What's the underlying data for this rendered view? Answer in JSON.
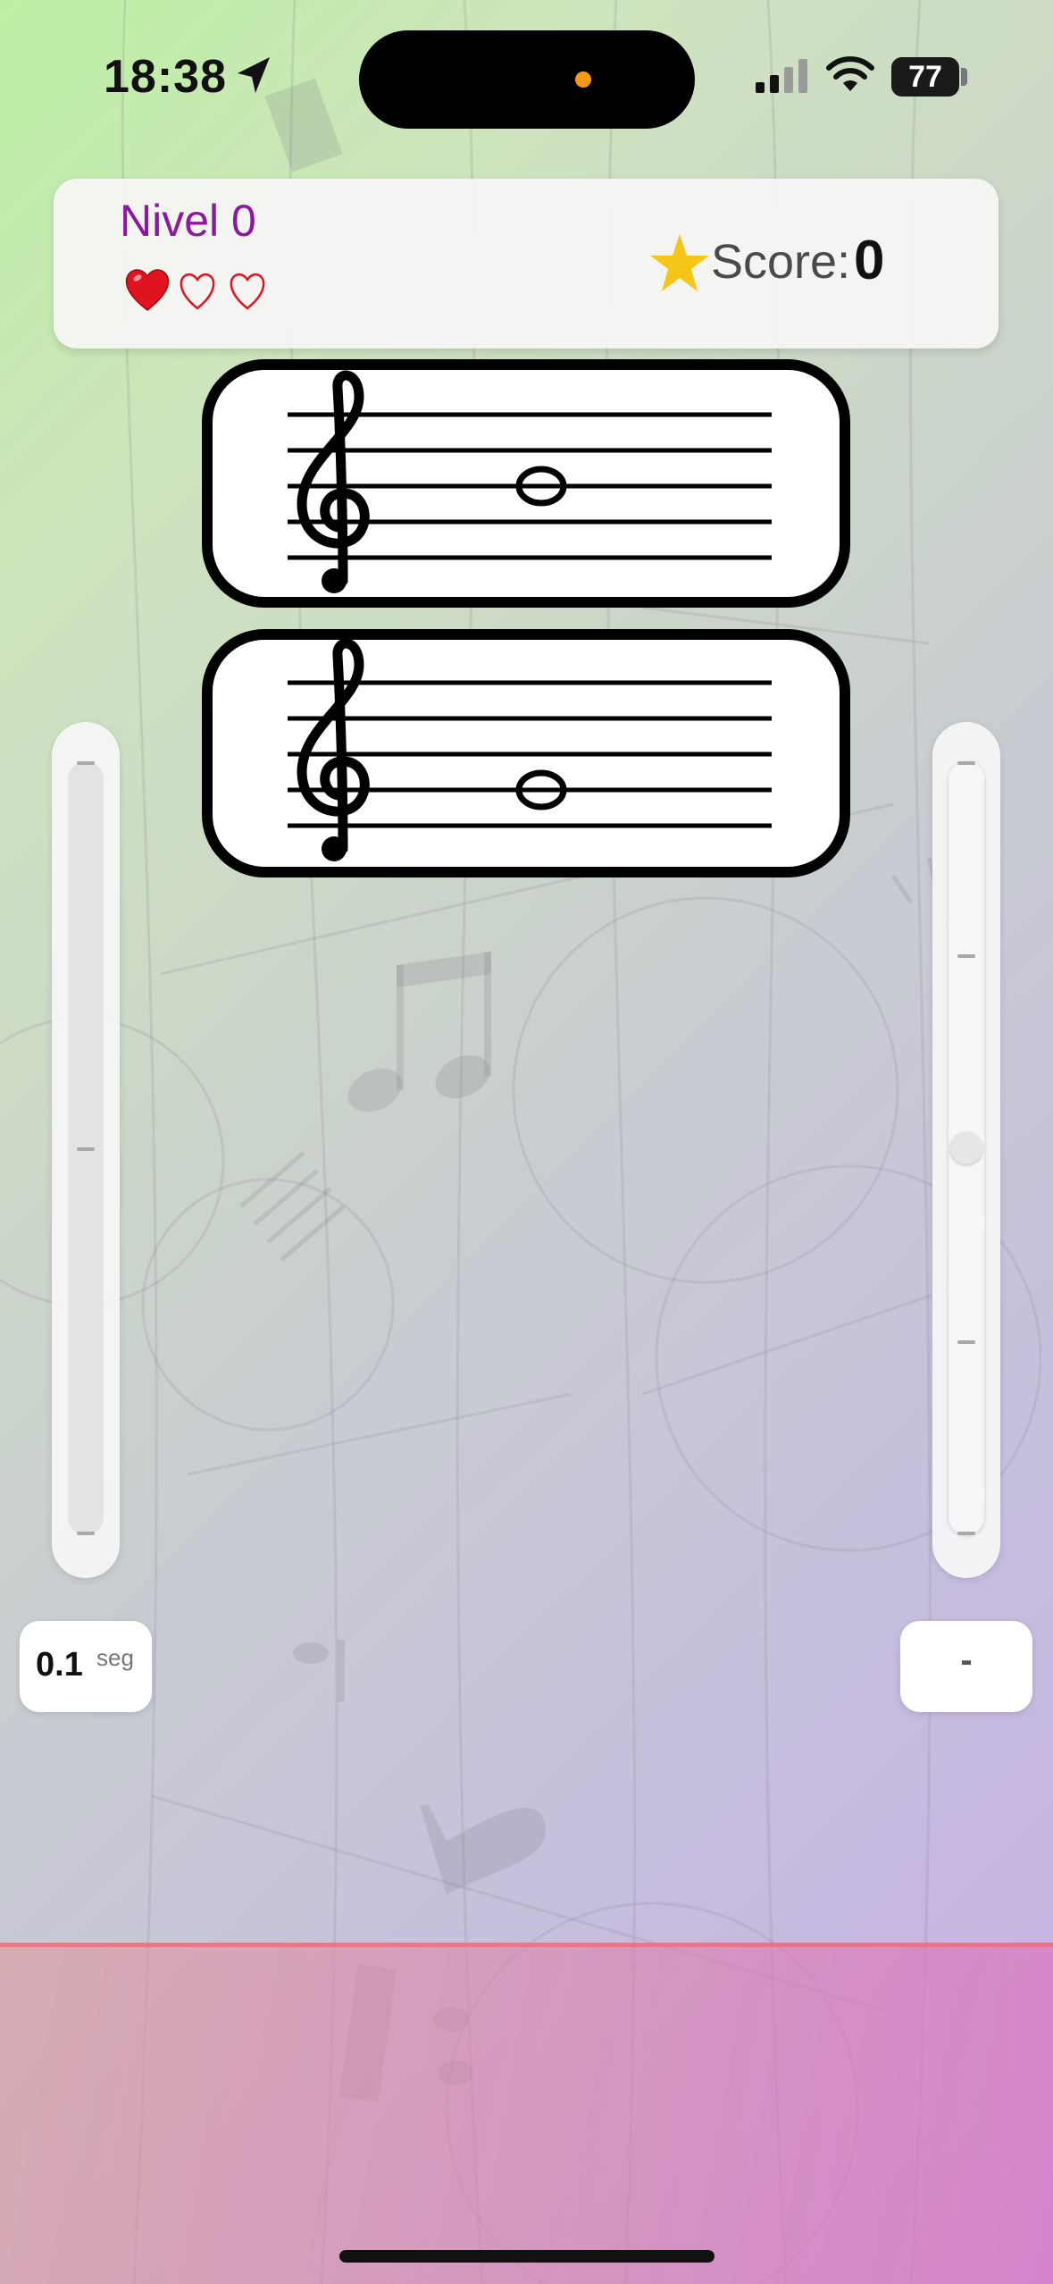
{
  "status_bar": {
    "time": "18:38",
    "battery": "77",
    "battery_fraction": 0.77
  },
  "header": {
    "level_label": "Nivel 0",
    "lives_total": 3,
    "lives_filled": 1,
    "filled_heart": "♥",
    "empty_heart": "♡",
    "score_label": "Score:",
    "score_value": "0"
  },
  "staffs": [
    {
      "clef": "treble-clef",
      "note": "whole-note",
      "note_position": "third-line"
    },
    {
      "clef": "treble-clef",
      "note": "whole-note",
      "note_position": "fourth-line"
    }
  ],
  "left_slider": {
    "value_number": "0.1",
    "value_unit": "seg"
  },
  "right_slider": {
    "value_text": "-",
    "level": 0.5
  },
  "colors": {
    "level_text": "#8b1a9e",
    "heart": "#e0141e",
    "star": "#f5c518",
    "divider": "#e86e78"
  }
}
